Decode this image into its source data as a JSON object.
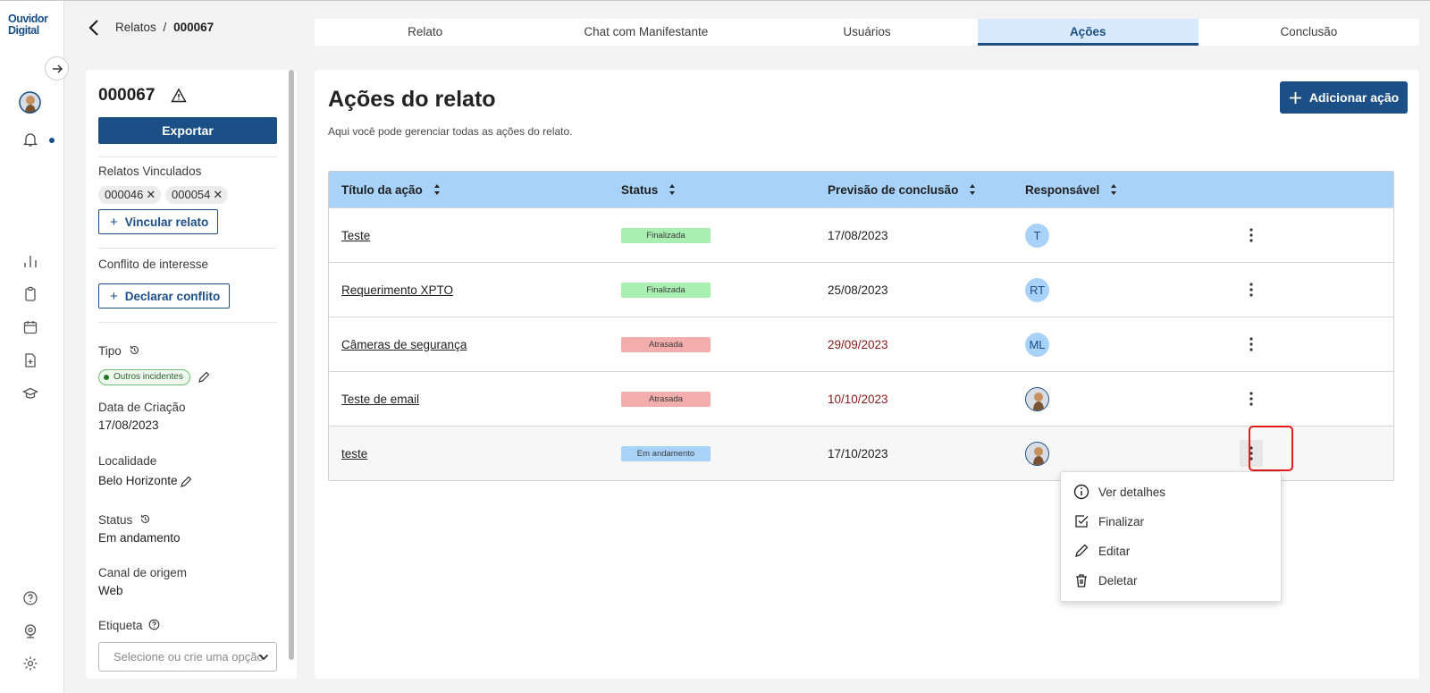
{
  "brand": {
    "logo_text": "Ouvidor Digital",
    "primary_color": "#1b4f86",
    "accent_header_color": "#a8d2f8"
  },
  "header": {
    "breadcrumb_parent": "Relatos",
    "breadcrumb_sep": "/",
    "breadcrumb_current": "000067"
  },
  "tabs": [
    {
      "label": "Relato"
    },
    {
      "label": "Chat com Manifestante"
    },
    {
      "label": "Usuários"
    },
    {
      "label": "Ações",
      "active": true
    },
    {
      "label": "Conclusão"
    }
  ],
  "side": {
    "report_id": "000067",
    "export_label": "Exportar",
    "linked_label": "Relatos Vinculados",
    "linked": [
      "000046",
      "000054"
    ],
    "link_button": "Vincular relato",
    "conflict_label": "Conflito de interesse",
    "conflict_button": "Declarar conflito",
    "type_label": "Tipo",
    "type_value": "Outros incidentes",
    "created_label": "Data de Criação",
    "created_value": "17/08/2023",
    "location_label": "Localidade",
    "location_value": "Belo Horizonte",
    "status_label": "Status",
    "status_value": "Em andamento",
    "channel_label": "Canal de origem",
    "channel_value": "Web",
    "tag_label": "Etiqueta",
    "tag_placeholder": "Selecione ou crie uma opção"
  },
  "main": {
    "title": "Ações do relato",
    "subtitle": "Aqui você pode gerenciar todas as ações do relato.",
    "add_button": "Adicionar ação",
    "columns": [
      "Título da ação",
      "Status",
      "Previsão de conclusão",
      "Responsável"
    ],
    "rows": [
      {
        "title": "Teste",
        "status": "Finalizada",
        "status_color": "#a9efb1",
        "date": "17/08/2023",
        "late": false,
        "resp": "T"
      },
      {
        "title": "Requerimento XPTO",
        "status": "Finalizada",
        "status_color": "#a9efb1",
        "date": "25/08/2023",
        "late": false,
        "resp": "RT"
      },
      {
        "title": "Câmeras de segurança",
        "status": "Atrasada",
        "status_color": "#f4adad",
        "date": "29/09/2023",
        "late": true,
        "resp": "ML"
      },
      {
        "title": "Teste de email",
        "status": "Atrasada",
        "status_color": "#f4adad",
        "date": "10/10/2023",
        "late": true,
        "resp": ""
      },
      {
        "title": "teste",
        "status": "Em andamento",
        "status_color": "#a8d2f8",
        "date": "17/10/2023",
        "late": false,
        "resp": ""
      }
    ]
  },
  "menu": {
    "items": [
      "Ver detalhes",
      "Finalizar",
      "Editar",
      "Deletar"
    ]
  },
  "icons": [
    "arrow-right-icon",
    "bell-icon",
    "chart-icon",
    "clipboard-icon",
    "calendar-icon",
    "file-plus-icon",
    "graduation-cap-icon",
    "help-icon",
    "webcam-icon",
    "gear-icon",
    "warning-icon",
    "history-icon",
    "pencil-icon",
    "help-circle-icon",
    "chevron-down-icon",
    "sort-icon",
    "kebab-icon",
    "info-icon",
    "check-square-icon",
    "trash-icon"
  ]
}
